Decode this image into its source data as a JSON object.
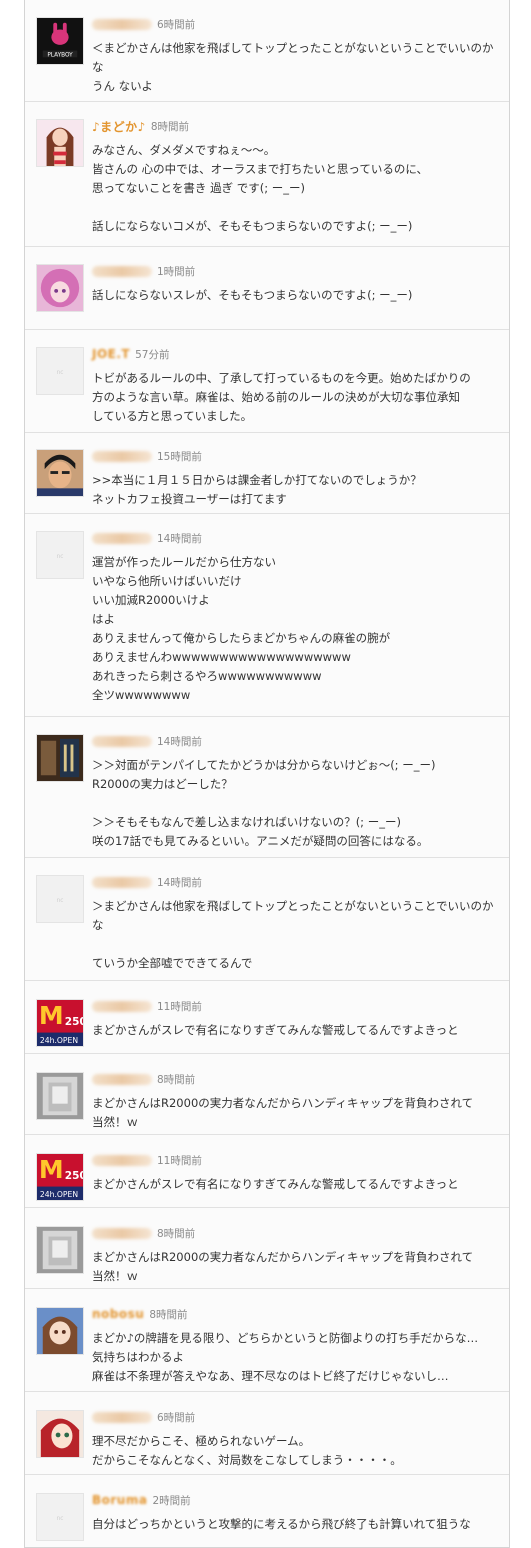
{
  "comments": [
    {
      "name": "",
      "name_style": "blur",
      "time": "6時間前",
      "avatar": "playboy-avatar",
      "lines": [
        "＜まどかさんは他家を飛ばしてトップとったことがないということでいいのか",
        "な",
        "うん ないよ"
      ]
    },
    {
      "name": "♪まどか♪",
      "name_style": "text",
      "time": "8時間前",
      "avatar": "swimsuit-girl-avatar",
      "lines": [
        "みなさん、ダメダメですねぇ〜〜。",
        "皆さんの 心の中では、オーラスまで打ちたいと思っているのに、",
        "思ってないことを書き 過ぎ です(; ー_ー)",
        "",
        "話しにならないコメが、そもそもつまらないのですよ(; ー_ー)"
      ]
    },
    {
      "name": "",
      "name_style": "blur",
      "time": "1時間前",
      "avatar": "pink-hair-avatar",
      "lines": [
        "話しにならないスレが、そもそもつまらないのですよ(; ー_ー)"
      ]
    },
    {
      "name": "JOE.T",
      "name_style": "blurtext",
      "time": "57分前",
      "avatar": "default-avatar",
      "lines": [
        "トビがあるルールの中、了承して打っているものを今更。始めたばかりの",
        "方のような言い草。麻雀は、始める前のルールの決めが大切な事位承知",
        "している方と思っていました。"
      ]
    },
    {
      "name": "",
      "name_style": "blur",
      "time": "15時間前",
      "avatar": "anime-man-avatar",
      "lines": [
        ">>本当に１月１５日からは課金者しか打てないのでしょうか？",
        "ネットカフェ投資ユーザーは打てます"
      ]
    },
    {
      "name": "",
      "name_style": "blur",
      "time": "14時間前",
      "avatar": "default-avatar",
      "lines": [
        "運営が作ったルールだから仕方ない",
        "いやなら他所いけばいいだけ",
        "いい加減R2000いけよ",
        "はよ",
        "ありえませんって俺からしたらまどかちゃんの麻雀の腕が",
        "ありえませんわwwwwwwwwwwwwwwwwwww",
        "あれきったら刺さるやろwwwwwwwwwww",
        "全ツwwwwwwww"
      ]
    },
    {
      "name": "",
      "name_style": "blur",
      "time": "14時間前",
      "avatar": "book-cover-avatar",
      "lines": [
        "＞＞対面がテンパイしてたかどうかは分からないけどぉ〜(; ー_ー)",
        "R2000の実力はどーした？",
        "",
        "＞＞そもそもなんで差し込まなければいけないの？(; ー_ー)",
        "咲の17話でも見てみるといい。アニメだが疑問の回答にはなる。"
      ]
    },
    {
      "name": "",
      "name_style": "blur",
      "time": "14時間前",
      "avatar": "default-avatar",
      "lines": [
        "＞まどかさんは他家を飛ばしてトップとったことがないということでいいのか",
        "な",
        "",
        "ていうか全部嘘でできてるんで"
      ]
    },
    {
      "name": "",
      "name_style": "blur",
      "time": "11時間前",
      "avatar": "mcdonalds-sign-avatar",
      "lines": [
        "まどかさんがスレで有名になりすぎてみんな警戒してるんですよきっと"
      ]
    },
    {
      "name": "",
      "name_style": "blur",
      "time": "8時間前",
      "avatar": "grayscale-photo-avatar",
      "lines": [
        "まどかさんはR2000の実力者なんだからハンディキャップを背負わされて",
        "当然！ｗ"
      ]
    },
    {
      "name": "",
      "name_style": "blur",
      "time": "11時間前",
      "avatar": "mcdonalds-sign-avatar",
      "lines": [
        "まどかさんがスレで有名になりすぎてみんな警戒してるんですよきっと"
      ]
    },
    {
      "name": "",
      "name_style": "blur",
      "time": "8時間前",
      "avatar": "grayscale-photo-avatar",
      "lines": [
        "まどかさんはR2000の実力者なんだからハンディキャップを背負わされて",
        "当然！ｗ"
      ]
    },
    {
      "name": "nobosu",
      "name_style": "blurtext",
      "time": "8時間前",
      "avatar": "brown-hair-girl-avatar",
      "lines": [
        "まどか♪の牌譜を見る限り、どちらかというと防御よりの打ち手だからな…",
        "気持ちはわかるよ",
        "麻雀は不条理が答えやなあ、理不尽なのはトビ終了だけじゃないし…"
      ]
    },
    {
      "name": "",
      "name_style": "blur",
      "time": "6時間前",
      "avatar": "red-hair-girl-avatar",
      "lines": [
        "理不尽だからこそ、極められないゲーム。",
        "だからこそなんとなく、対局数をこなしてしまう・・・・。"
      ]
    },
    {
      "name": "Boruma",
      "name_style": "blurtext",
      "time": "2時間前",
      "avatar": "default-avatar",
      "lines": [
        "自分はどっちかというと攻撃的に考えるから飛び終了も計算いれて狙うな"
      ]
    }
  ]
}
